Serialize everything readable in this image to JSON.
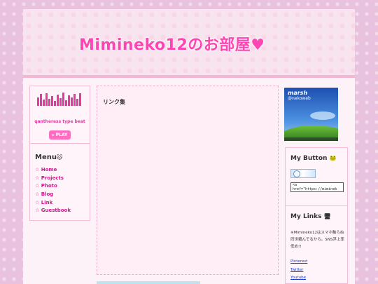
{
  "header": {
    "title": "Mimineko12のお部屋♥"
  },
  "player": {
    "track": "qantheress type beat",
    "play_label": "PLAY",
    "eq_levels": [
      0.6,
      0.85,
      0.45,
      0.9,
      0.5,
      0.7,
      0.35,
      0.8,
      0.55,
      0.95,
      0.4,
      0.75,
      0.6,
      0.85,
      0.5,
      0.9
    ]
  },
  "menu": {
    "heading": "Menu",
    "items": [
      {
        "label": "☆ Home"
      },
      {
        "label": "☆ Projects"
      },
      {
        "label": "☆ Photo"
      },
      {
        "label": "☆ Blog"
      },
      {
        "label": "☆ Link"
      },
      {
        "label": "☆ Guestbook"
      }
    ]
  },
  "main": {
    "title": "リンク集"
  },
  "banner": {
    "name": "marsh",
    "handle": "@nekoweb"
  },
  "my_button": {
    "heading": "My Button",
    "code": "<a\nhref=\"https://miminek"
  },
  "my_links": {
    "heading": "My Links",
    "note": "※Mimineko12はスマホ触らぬ同世類んでるから。SNS浮上率低め!!",
    "items": [
      {
        "label": "Pinterest"
      },
      {
        "label": "Twitter"
      },
      {
        "label": "Youtube"
      }
    ]
  },
  "colors": {
    "accent": "#ff44b4",
    "link_pink": "#d4188f",
    "border": "#f3bcd7"
  }
}
